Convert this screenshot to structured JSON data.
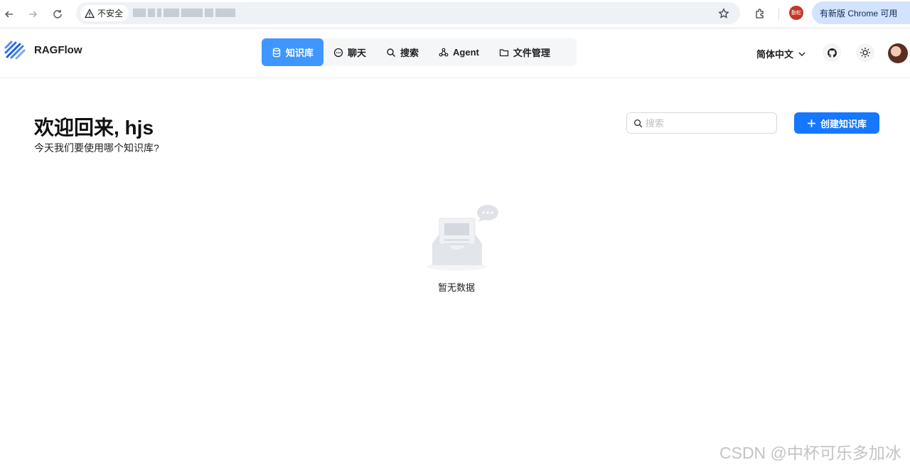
{
  "browser": {
    "security_label": "不安全",
    "update_label": "有新版 Chrome 可用",
    "profile_label": "勤松"
  },
  "header": {
    "brand": "RAGFlow",
    "nav": [
      {
        "label": "知识库",
        "icon": "database-icon",
        "active": true
      },
      {
        "label": "聊天",
        "icon": "chat-icon",
        "active": false
      },
      {
        "label": "搜索",
        "icon": "search-icon",
        "active": false
      },
      {
        "label": "Agent",
        "icon": "agent-icon",
        "active": false
      },
      {
        "label": "文件管理",
        "icon": "folder-icon",
        "active": false
      }
    ],
    "language": "简体中文"
  },
  "main": {
    "welcome": "欢迎回来, hjs",
    "subtitle": "今天我们要使用哪个知识库?",
    "search_placeholder": "搜索",
    "create_button": "创建知识库",
    "empty_text": "暂无数据"
  },
  "watermark": "CSDN @中杯可乐多加冰",
  "colors": {
    "accent": "#1677ff",
    "active_tab": "#4096ff"
  }
}
